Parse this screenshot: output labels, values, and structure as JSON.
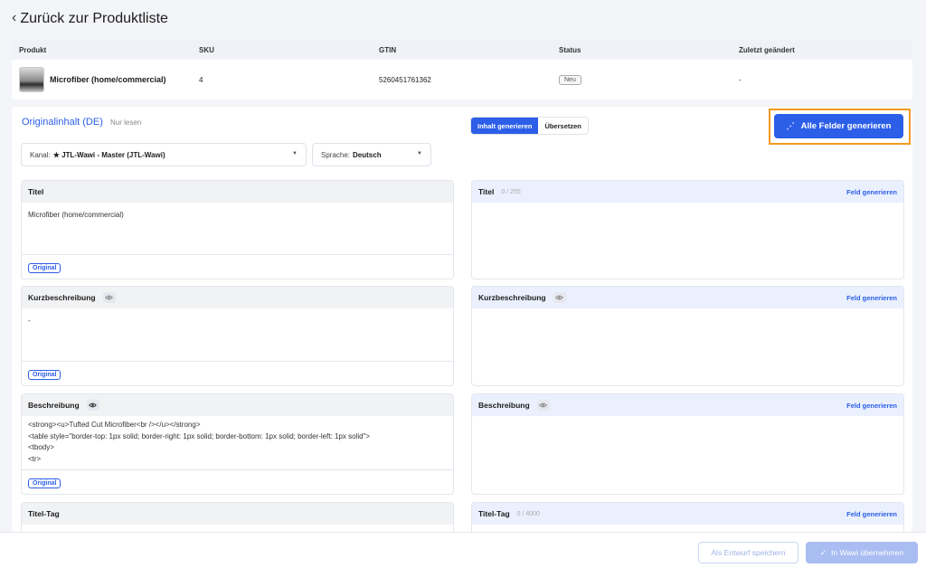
{
  "header": {
    "back_label": "Zurück zur Produktliste"
  },
  "product_table": {
    "columns": [
      "Produkt",
      "SKU",
      "GTIN",
      "Status",
      "Zuletzt geändert"
    ],
    "row": {
      "name": "Microfiber (home/commercial)",
      "sku": "4",
      "gtin": "5260451761362",
      "status": "Neu",
      "modified": "-"
    }
  },
  "content": {
    "title": "Originalinhalt (DE)",
    "readonly": "Nur lesen",
    "tabs": [
      "Inhalt generieren",
      "Übersetzen"
    ],
    "generate_all": "Alle Felder generieren",
    "channel": {
      "label": "Kanal:",
      "value": "★ JTL-Wawi - Master (JTL-Wawi)"
    },
    "language": {
      "label": "Sprache:",
      "value": "Deutsch"
    }
  },
  "left_fields": [
    {
      "title": "Titel",
      "value": "Microfiber (home/commercial)",
      "badge": "Original"
    },
    {
      "title": "Kurzbeschreibung",
      "value": "-",
      "badge": "Original"
    },
    {
      "title": "Beschreibung",
      "lines": [
        "<strong><u>Tufted Cut Microfiber<br /></u></strong>",
        "<table style=\"border-top: 1px solid; border-right: 1px solid; border-bottom: 1px solid; border-left: 1px solid\">",
        "<tbody>",
        "<tr>"
      ],
      "badge": "Original"
    },
    {
      "title": "Titel-Tag"
    }
  ],
  "right_fields": [
    {
      "title": "Titel",
      "count": "0 / 255",
      "action": "Feld generieren"
    },
    {
      "title": "Kurzbeschreibung",
      "action": "Feld generieren"
    },
    {
      "title": "Beschreibung",
      "action": "Feld generieren"
    },
    {
      "title": "Titel-Tag",
      "count": "0 / 4000",
      "action": "Feld generieren"
    }
  ],
  "footer": {
    "draft": "Als Entwurf speichern",
    "apply": "In Wawi übernehmen"
  },
  "colors": {
    "accent": "#2c5ee8",
    "highlight": "#f39a1e"
  }
}
